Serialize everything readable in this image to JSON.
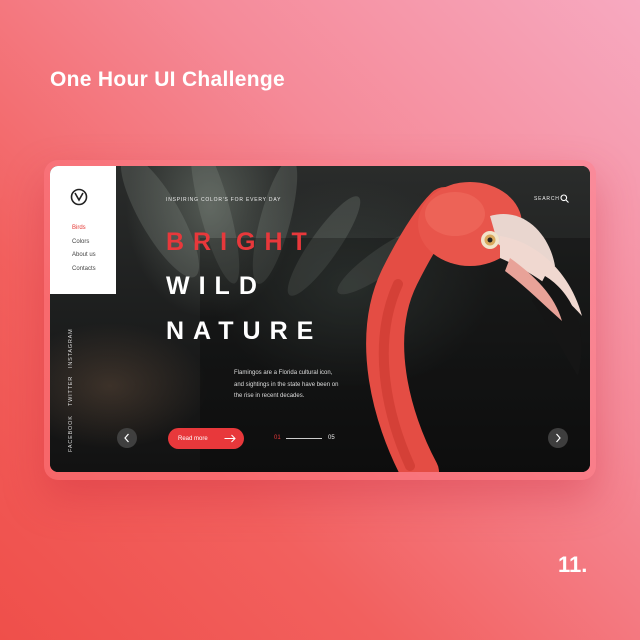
{
  "challenge": {
    "title": "One Hour UI Challenge",
    "number": "11."
  },
  "header": {
    "tagline": "INSPIRING COLOR'S FOR EVERY DAY",
    "search_label": "SEARCH",
    "search_icon": "search-icon"
  },
  "menu": {
    "logo": "logo-icon",
    "items": [
      {
        "label": "Birds",
        "active": true
      },
      {
        "label": "Colors",
        "active": false
      },
      {
        "label": "About us",
        "active": false
      },
      {
        "label": "Contacts",
        "active": false
      }
    ]
  },
  "social": [
    "INSTAGRAM",
    "TWITTER",
    "FACEBOOK"
  ],
  "hero": {
    "line1": "BRIGHT",
    "line2": "WILD",
    "line3": "NATURE",
    "description": "Flamingos are a Florida cultural icon, and sightings in the state have been on the rise in recent decades.",
    "button_label": "Read more",
    "button_icon": "arrow-right-icon"
  },
  "pager": {
    "current": "01",
    "total": "05"
  },
  "navigation": {
    "prev_icon": "chevron-left-icon",
    "next_icon": "chevron-right-icon"
  },
  "colors": {
    "accent": "#e8383b",
    "background_top": "#f7a9c0",
    "background_bottom": "#ef4f4a"
  }
}
